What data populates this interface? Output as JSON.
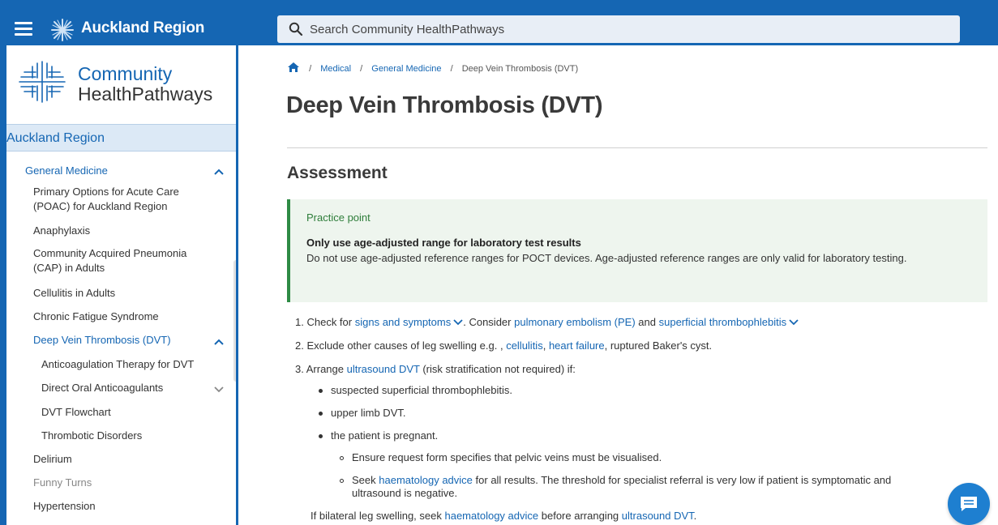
{
  "header": {
    "region_title": "Auckland Region",
    "search_placeholder": "Search Community HealthPathways"
  },
  "sidebar": {
    "logo_line1": "Community",
    "logo_line2": "HealthPathways",
    "region": "Auckland Region",
    "items": [
      {
        "label": "General Medicine"
      },
      {
        "label": "Primary Options for Acute Care"
      },
      {
        "label": "(POAC) for Auckland Region"
      },
      {
        "label": "Anaphylaxis"
      },
      {
        "label": "Community Acquired Pneumonia"
      },
      {
        "label": "(CAP) in Adults"
      },
      {
        "label": "Cellulitis in Adults"
      },
      {
        "label": "Chronic Fatigue Syndrome"
      },
      {
        "label": "Deep Vein Thrombosis (DVT)"
      },
      {
        "label": "Anticoagulation Therapy for DVT"
      },
      {
        "label": "Direct Oral Anticoagulants"
      },
      {
        "label": "DVT Flowchart"
      },
      {
        "label": "Thrombotic Disorders"
      },
      {
        "label": "Delirium"
      },
      {
        "label": "Funny Turns"
      },
      {
        "label": "Hypertension"
      }
    ]
  },
  "breadcrumb": {
    "medical": "Medical",
    "general_medicine": "General Medicine",
    "current": "Deep Vein Thrombosis (DVT)",
    "sep": "/"
  },
  "page": {
    "title": "Deep Vein Thrombosis (DVT)",
    "section": "Assessment"
  },
  "practice_point": {
    "label": "Practice point",
    "heading": "Only use age-adjusted range for laboratory test results",
    "body": "Do not use age-adjusted reference ranges for POCT devices. Age-adjusted reference ranges are only valid for laboratory testing."
  },
  "steps": {
    "s1_num": "1.",
    "s1_a": "Check for",
    "s1_link1": "signs and symptoms",
    "s1_b": ". Consider",
    "s1_link2": "pulmonary embolism (PE)",
    "s1_c": "and",
    "s1_link3": "superficial thrombophlebitis",
    "s2_num": "2.",
    "s2_a": "Exclude other causes of leg swelling e.g. ,",
    "s2_link1": "cellulitis",
    "s2_comma": ",",
    "s2_link2": "heart failure",
    "s2_b": ", ruptured Baker's cyst.",
    "s3_num": "3.",
    "s3_a": "Arrange",
    "s3_link1": "ultrasound DVT",
    "s3_b": "(risk stratification not required) if:",
    "b1": "suspected superficial thrombophlebitis.",
    "b2": "upper limb DVT.",
    "b3": "the patient is pregnant.",
    "sb1": "Ensure request form specifies that pelvic veins must be visualised.",
    "sb2_a": "Seek",
    "sb2_link": "haematology advice",
    "sb2_b": "for all results. The threshold for specialist referral is very low if patient is symptomatic and",
    "sb2_c": "ultrasound is negative.",
    "last_a": "If bilateral leg swelling, seek",
    "last_link1": "haematology advice",
    "last_b": "before arranging",
    "last_link2": "ultrasound DVT",
    "last_c": "."
  }
}
